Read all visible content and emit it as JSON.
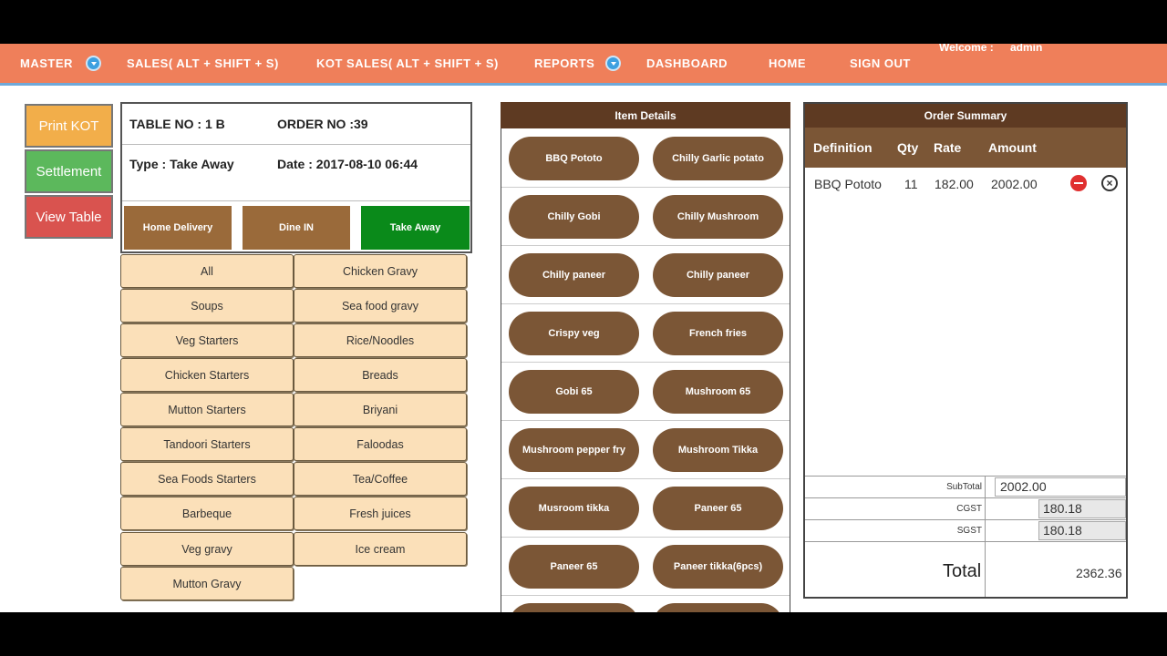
{
  "nav": {
    "master": "MASTER",
    "sales": "SALES( ALT + SHIFT + S)",
    "kot_sales": "KOT SALES( ALT + SHIFT + S)",
    "reports": "REPORTS",
    "dashboard": "DASHBOARD",
    "home": "HOME",
    "sign_out": "SIGN OUT",
    "welcome_label": "Welcome :",
    "welcome_user": "admin"
  },
  "actions": {
    "print_kot": "Print KOT",
    "settlement": "Settlement",
    "view_table": "View Table",
    "colors": {
      "print_kot": "#f2ae4a",
      "settlement": "#5cb85c",
      "view_table": "#d9534f"
    }
  },
  "order": {
    "table_no": "TABLE NO : 1 B",
    "order_no": "ORDER NO :39",
    "type": "Type : Take Away",
    "date": "Date : 2017-08-10 06:44"
  },
  "order_types": {
    "home_delivery": "Home Delivery",
    "dine_in": "Dine IN",
    "take_away": "Take Away",
    "selected": "take_away"
  },
  "categories": {
    "left": [
      "All",
      "Soups",
      "Veg Starters",
      "Chicken Starters",
      "Mutton Starters",
      "Tandoori Starters",
      "Sea Foods Starters",
      "Barbeque",
      "Veg gravy",
      "Mutton Gravy"
    ],
    "right": [
      "Chicken Gravy",
      "Sea food gravy",
      "Rice/Noodles",
      "Breads",
      "Briyani",
      "Faloodas",
      "Tea/Coffee",
      "Fresh juices",
      "Ice cream"
    ]
  },
  "item_details": {
    "title": "Item Details",
    "items": [
      "BBQ Pototo",
      "Chilly Garlic potato",
      "Chilly Gobi",
      "Chilly Mushroom",
      "Chilly paneer",
      "Chilly paneer",
      "Crispy veg",
      "French fries",
      "Gobi 65",
      "Mushroom 65",
      "Mushroom pepper fry",
      "Mushroom Tikka",
      "Musroom tikka",
      "Paneer 65",
      "Paneer 65",
      "Paneer tikka(6pcs)",
      "",
      ""
    ]
  },
  "summary": {
    "title": "Order Summary",
    "columns": {
      "definition": "Definition",
      "qty": "Qty",
      "rate": "Rate",
      "amount": "Amount"
    },
    "rows": [
      {
        "definition": "BBQ Pototo",
        "qty": "11",
        "rate": "182.00",
        "amount": "2002.00"
      }
    ],
    "subtotal_label": "SubTotal",
    "subtotal": "2002.00",
    "cgst_label": "CGST",
    "cgst": "180.18",
    "sgst_label": "SGST",
    "sgst": "180.18",
    "total_label": "Total",
    "total": "2362.36"
  }
}
